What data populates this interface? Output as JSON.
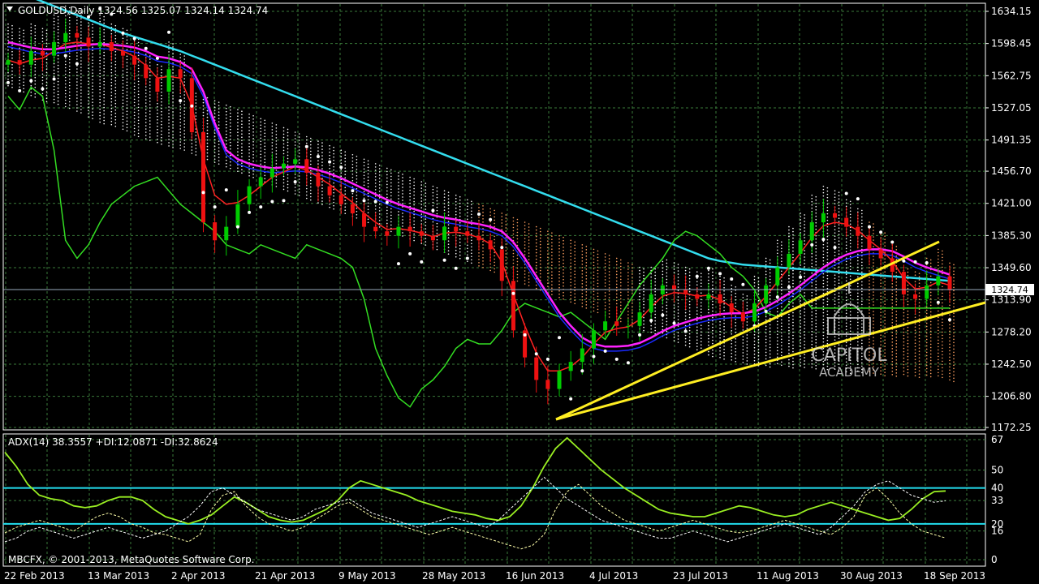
{
  "symbol_line": "GOLDUSD,Daily  1324.56 1325.07 1324.14 1324.74",
  "adx_line": "ADX(14) 38.3557 +DI:12.0871 -DI:32.8624",
  "copyright": "MBCFX, © 2001-2013, MetaQuotes Software Corp.",
  "watermark": {
    "line1": "CAPITOL",
    "line2": "ACADEMY"
  },
  "current_price_label": "1324.74",
  "colors": {
    "background": "#000000",
    "grid": "#3a7a3a",
    "axis": "#ffffff",
    "bull_candle": "#00cc00",
    "bear_candle": "#ee1111",
    "ema_fast": "#ff2222",
    "ema_mid": "#ff22ff",
    "sma_slow": "#33ddee",
    "kijun": "#1a2aff",
    "chikou": "#33dd22",
    "parabolic_sar": "#ffffff",
    "kumo_cloud": "#ffffff",
    "kumo_orange": "#ffa060",
    "trendline": "#ffee22",
    "adx_line": "#99ee22",
    "plus_di": "#ffffaa",
    "minus_di": "#ffffff",
    "adx_levels": "#22ddee"
  },
  "chart_data": [
    {
      "type": "candlestick",
      "title": "GOLDUSD,Daily",
      "ohlc_last": {
        "open": 1324.56,
        "high": 1325.07,
        "low": 1324.14,
        "close": 1324.74
      },
      "ylim": [
        1172.25,
        1634.15
      ],
      "y_ticks": [
        "1634.15",
        "1598.45",
        "1562.75",
        "1527.05",
        "1491.35",
        "1456.70",
        "1421.00",
        "1385.30",
        "1349.60",
        "1313.90",
        "1278.20",
        "1242.50",
        "1206.80",
        "1172.25"
      ],
      "x_ticks": [
        "22 Feb 2013",
        "13 Mar 2013",
        "2 Apr 2013",
        "21 Apr 2013",
        "9 May 2013",
        "28 May 2013",
        "16 Jun 2013",
        "4 Jul 2013",
        "23 Jul 2013",
        "11 Aug 2013",
        "30 Aug 2013",
        "18 Sep 2013"
      ],
      "close_series": [
        1580,
        1575,
        1590,
        1585,
        1600,
        1610,
        1605,
        1595,
        1600,
        1590,
        1585,
        1575,
        1560,
        1545,
        1570,
        1560,
        1500,
        1400,
        1380,
        1395,
        1420,
        1440,
        1450,
        1460,
        1465,
        1470,
        1455,
        1440,
        1430,
        1420,
        1410,
        1395,
        1390,
        1385,
        1395,
        1390,
        1385,
        1380,
        1395,
        1390,
        1385,
        1380,
        1370,
        1335,
        1280,
        1250,
        1225,
        1215,
        1235,
        1245,
        1260,
        1280,
        1290,
        1285,
        1285,
        1300,
        1320,
        1330,
        1325,
        1320,
        1315,
        1320,
        1310,
        1300,
        1290,
        1310,
        1330,
        1350,
        1365,
        1380,
        1400,
        1410,
        1405,
        1395,
        1385,
        1370,
        1360,
        1345,
        1320,
        1315,
        1330,
        1340,
        1324.74
      ],
      "overlays": {
        "ema_fast": [
          1580,
          1576,
          1580,
          1582,
          1590,
          1598,
          1600,
          1598,
          1598,
          1594,
          1590,
          1584,
          1574,
          1560,
          1562,
          1560,
          1530,
          1470,
          1430,
          1420,
          1422,
          1430,
          1440,
          1450,
          1456,
          1462,
          1458,
          1450,
          1442,
          1432,
          1422,
          1410,
          1400,
          1392,
          1393,
          1391,
          1388,
          1384,
          1388,
          1389,
          1387,
          1383,
          1376,
          1356,
          1320,
          1285,
          1255,
          1235,
          1235,
          1240,
          1250,
          1265,
          1278,
          1282,
          1284,
          1292,
          1306,
          1318,
          1322,
          1321,
          1318,
          1319,
          1314,
          1306,
          1298,
          1304,
          1318,
          1334,
          1350,
          1366,
          1383,
          1396,
          1400,
          1398,
          1391,
          1380,
          1370,
          1357,
          1338,
          1326,
          1328,
          1334,
          1330
        ],
        "ema_mid": [
          1600,
          1597,
          1594,
          1592,
          1592,
          1594,
          1596,
          1597,
          1598,
          1597,
          1596,
          1594,
          1590,
          1584,
          1582,
          1578,
          1570,
          1545,
          1510,
          1480,
          1470,
          1465,
          1462,
          1460,
          1461,
          1462,
          1461,
          1458,
          1454,
          1449,
          1443,
          1437,
          1431,
          1425,
          1420,
          1416,
          1412,
          1408,
          1405,
          1403,
          1400,
          1398,
          1395,
          1390,
          1378,
          1360,
          1340,
          1320,
          1300,
          1285,
          1272,
          1265,
          1262,
          1262,
          1263,
          1266,
          1272,
          1279,
          1285,
          1289,
          1293,
          1296,
          1298,
          1299,
          1299,
          1301,
          1306,
          1313,
          1321,
          1330,
          1340,
          1350,
          1358,
          1364,
          1368,
          1370,
          1370,
          1368,
          1362,
          1355,
          1350,
          1346,
          1342
        ],
        "sma_slow": [
          1660,
          1655,
          1650,
          1645,
          1640,
          1635,
          1630,
          1625,
          1620,
          1615,
          1610,
          1606,
          1602,
          1598,
          1594,
          1590,
          1585,
          1580,
          1575,
          1570,
          1565,
          1560,
          1555,
          1550,
          1545,
          1540,
          1535,
          1530,
          1525,
          1520,
          1515,
          1510,
          1505,
          1500,
          1495,
          1490,
          1485,
          1480,
          1475,
          1470,
          1465,
          1460,
          1455,
          1450,
          1445,
          1440,
          1435,
          1430,
          1425,
          1420,
          1415,
          1410,
          1405,
          1400,
          1395,
          1390,
          1385,
          1380,
          1375,
          1370,
          1365,
          1360,
          1357,
          1355,
          1353,
          1352,
          1351,
          1350,
          1349,
          1348,
          1347,
          1346,
          1345,
          1344,
          1343,
          1342,
          1341,
          1340,
          1339,
          1338,
          1337,
          1336,
          1335
        ]
      }
    },
    {
      "type": "line",
      "title": "ADX(14) 38.3557 +DI:12.0871 -DI:32.8624",
      "ylim": [
        0,
        67
      ],
      "y_ticks": [
        "67",
        "50",
        "40",
        "33",
        "20",
        "16",
        "0"
      ],
      "levels": [
        40,
        20
      ],
      "series": [
        {
          "name": "ADX(14)",
          "values": [
            60,
            52,
            42,
            36,
            34,
            33,
            30,
            29,
            30,
            33,
            35,
            35,
            33,
            28,
            24,
            22,
            20,
            22,
            25,
            30,
            35,
            32,
            28,
            24,
            22,
            21,
            22,
            25,
            28,
            33,
            40,
            44,
            42,
            40,
            38,
            36,
            33,
            31,
            29,
            27,
            26,
            25,
            23,
            22,
            24,
            30,
            40,
            52,
            62,
            68,
            62,
            56,
            50,
            45,
            40,
            36,
            32,
            28,
            26,
            25,
            24,
            24,
            26,
            28,
            30,
            29,
            27,
            25,
            24,
            25,
            28,
            30,
            32,
            30,
            28,
            26,
            24,
            22,
            23,
            28,
            34,
            38,
            38.36
          ]
        },
        {
          "name": "+DI",
          "values": [
            15,
            18,
            20,
            22,
            20,
            18,
            16,
            20,
            24,
            26,
            24,
            20,
            18,
            15,
            14,
            12,
            10,
            14,
            28,
            36,
            38,
            30,
            24,
            20,
            18,
            16,
            18,
            22,
            26,
            30,
            32,
            28,
            24,
            22,
            20,
            18,
            16,
            14,
            16,
            18,
            16,
            14,
            12,
            10,
            8,
            6,
            8,
            14,
            28,
            38,
            42,
            36,
            30,
            26,
            22,
            20,
            18,
            16,
            18,
            20,
            22,
            20,
            18,
            16,
            15,
            16,
            18,
            20,
            22,
            20,
            18,
            16,
            14,
            18,
            24,
            36,
            40,
            34,
            26,
            20,
            16,
            14,
            12.09
          ]
        },
        {
          "name": "-DI",
          "values": [
            10,
            12,
            16,
            18,
            16,
            14,
            12,
            14,
            16,
            18,
            16,
            14,
            12,
            14,
            16,
            20,
            24,
            30,
            38,
            40,
            36,
            32,
            28,
            26,
            24,
            22,
            24,
            28,
            30,
            32,
            34,
            30,
            26,
            24,
            22,
            20,
            18,
            20,
            22,
            24,
            22,
            20,
            18,
            22,
            28,
            34,
            40,
            46,
            40,
            34,
            30,
            26,
            22,
            20,
            18,
            16,
            14,
            12,
            12,
            14,
            16,
            14,
            12,
            10,
            12,
            14,
            16,
            18,
            20,
            18,
            16,
            14,
            18,
            24,
            30,
            38,
            42,
            44,
            40,
            36,
            34,
            32,
            32.86
          ]
        }
      ]
    }
  ]
}
